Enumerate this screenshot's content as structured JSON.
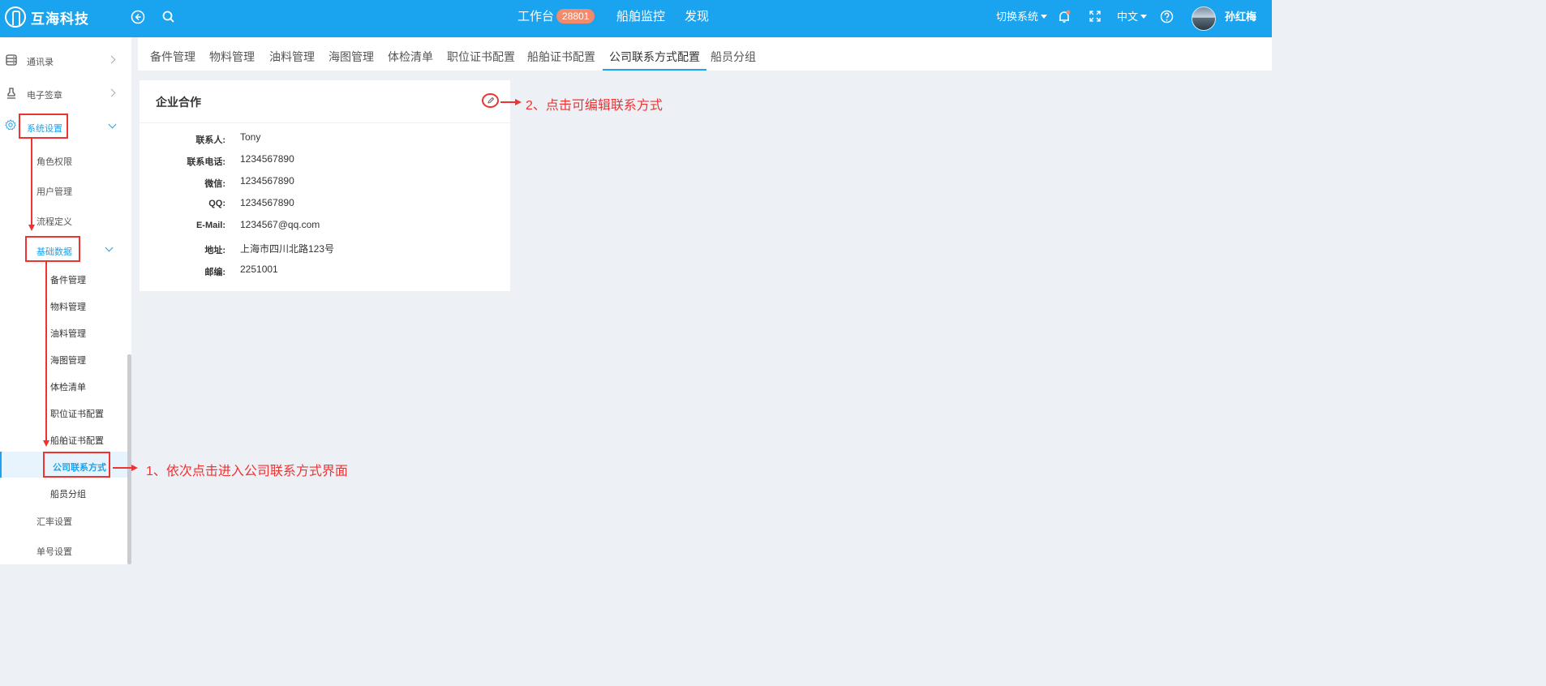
{
  "header": {
    "brand": "互海科技",
    "nav": [
      {
        "label": "工作台",
        "badge": "28801"
      },
      {
        "label": "船舶监控"
      },
      {
        "label": "发现"
      }
    ],
    "switch_system": "切换系统",
    "language": "中文",
    "user_name": "孙红梅",
    "accent": "#1aa3ee"
  },
  "sidebar": {
    "top_items": [
      {
        "label": "通讯录",
        "icon": "address-book-icon"
      },
      {
        "label": "电子签章",
        "icon": "stamp-icon"
      },
      {
        "label": "系统设置",
        "icon": "gear-icon"
      }
    ],
    "system_children": [
      "角色权限",
      "用户管理",
      "流程定义"
    ],
    "basic_data_label": "基础数据",
    "basic_data_children": [
      "备件管理",
      "物料管理",
      "油料管理",
      "海图管理",
      "体检清单",
      "职位证书配置",
      "船舶证书配置",
      "公司联系方式",
      "船员分组"
    ],
    "after_items": [
      "汇率设置",
      "单号设置"
    ],
    "active_item": "公司联系方式"
  },
  "tabs": [
    "备件管理",
    "物料管理",
    "油料管理",
    "海图管理",
    "体检清单",
    "职位证书配置",
    "船舶证书配置",
    "公司联系方式配置",
    "船员分组"
  ],
  "active_tab": "公司联系方式配置",
  "card": {
    "title": "企业合作",
    "fields": [
      {
        "label": "联系人:",
        "value": "Tony"
      },
      {
        "label": "联系电话:",
        "value": "1234567890"
      },
      {
        "label": "微信:",
        "value": "1234567890"
      },
      {
        "label": "QQ:",
        "value": "1234567890"
      },
      {
        "label": "E-Mail:",
        "value": "1234567@qq.com"
      },
      {
        "label": "地址:",
        "value": "上海市四川北路123号"
      },
      {
        "label": "邮编:",
        "value": "2251001"
      }
    ]
  },
  "annotations": {
    "step1": "1、依次点击进入公司联系方式界面",
    "step2": "2、点击可编辑联系方式"
  }
}
